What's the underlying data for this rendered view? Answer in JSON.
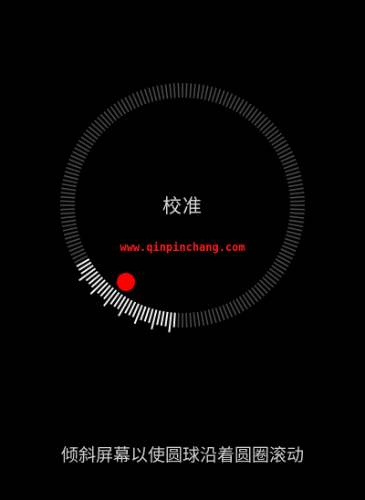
{
  "calibration": {
    "title": "校准",
    "instruction": "倾斜屏幕以使圆球沿着圆圈滚动",
    "progress_fraction": 0.16,
    "ball_color": "#ff0000"
  },
  "watermark": {
    "text": "www.qinpinchang.com"
  },
  "colors": {
    "background": "#000000",
    "tick_dim": "#4a4a4a",
    "tick_lit": "#f2f2f2",
    "text": "#d8d8d8"
  }
}
